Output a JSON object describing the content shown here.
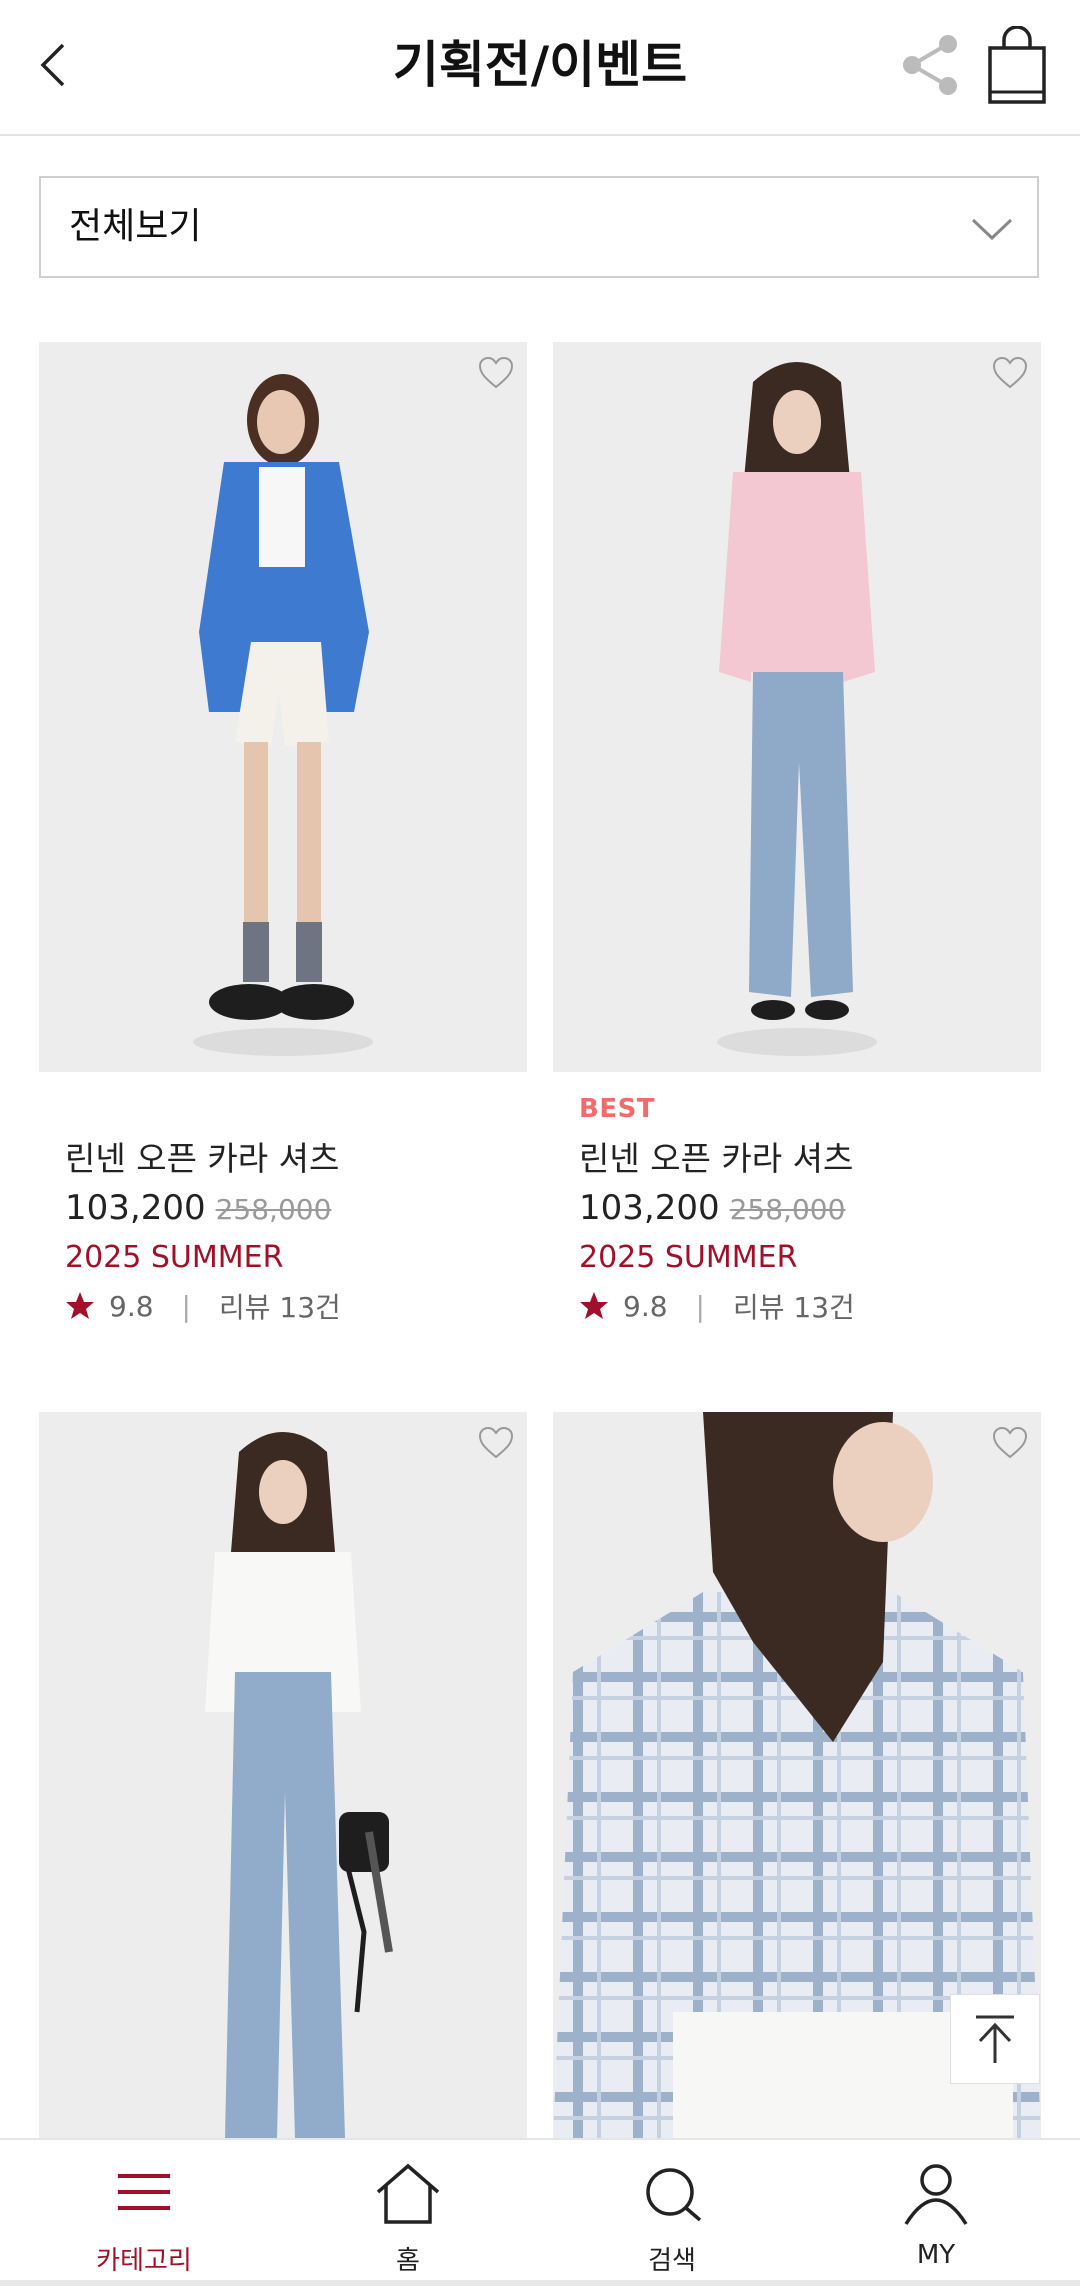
{
  "header": {
    "title": "기획전/이벤트",
    "back_icon": "chevron-left-icon",
    "share_icon": "share-icon",
    "bag_icon": "shopping-bag-icon"
  },
  "filter": {
    "selected": "전체보기",
    "chevron_icon": "chevron-down-icon"
  },
  "products": [
    {
      "image": "model in blue linen shirt and white shorts",
      "badge": "",
      "name": "린넨 오픈 카라 셔츠",
      "price": "103,200",
      "original_price": "258,000",
      "season": "2025 SUMMER",
      "rating": "9.8",
      "reviews": "리뷰 13건"
    },
    {
      "image": "model in pink linen shirt and jeans",
      "badge": "BEST",
      "name": "린넨 오픈 카라 셔츠",
      "price": "103,200",
      "original_price": "258,000",
      "season": "2025 SUMMER",
      "rating": "9.8",
      "reviews": "리뷰 13건"
    },
    {
      "image": "model in white shirt and wide jeans with bag"
    },
    {
      "image": "model in blue plaid check shirt"
    }
  ],
  "bottom_nav": {
    "items": [
      {
        "label": "카테고리",
        "icon": "menu-icon",
        "active": true
      },
      {
        "label": "홈",
        "icon": "home-icon",
        "active": false
      },
      {
        "label": "검색",
        "icon": "search-icon",
        "active": false
      },
      {
        "label": "MY",
        "icon": "user-icon",
        "active": false
      }
    ]
  },
  "colors": {
    "accent": "#a0102a",
    "badge": "#f26a6a",
    "image_bg": "#eeeded"
  }
}
